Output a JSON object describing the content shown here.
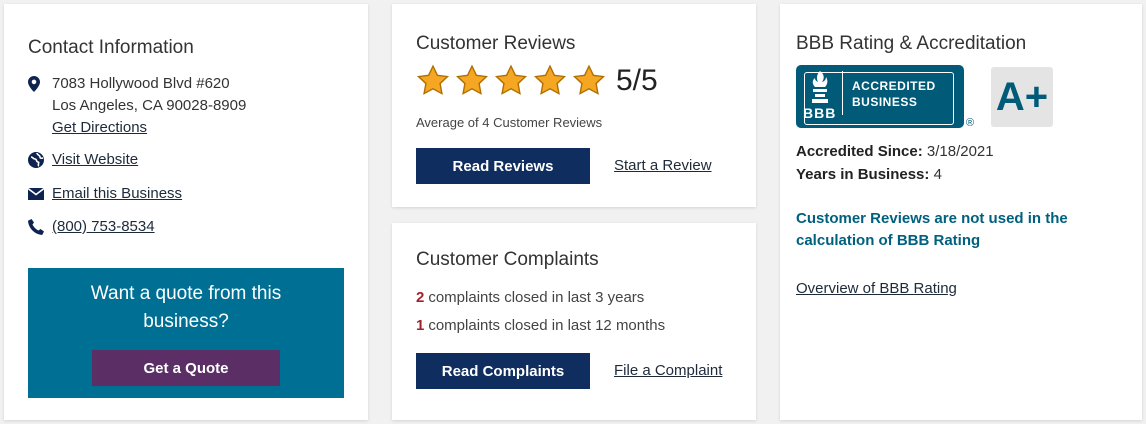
{
  "contact": {
    "title": "Contact Information",
    "address_line1": "7083 Hollywood Blvd #620",
    "address_line2": "Los Angeles, CA 90028-8909",
    "directions_label": "Get Directions",
    "website_label": "Visit Website",
    "email_label": "Email this Business",
    "phone": "(800) 753-8534",
    "quote_prompt": "Want a quote from this business?",
    "quote_button": "Get a Quote"
  },
  "reviews": {
    "title": "Customer Reviews",
    "stars": 5,
    "rating_text": "5/5",
    "average_text": "Average of 4 Customer Reviews",
    "read_button": "Read Reviews",
    "start_link": "Start a Review"
  },
  "complaints": {
    "title": "Customer Complaints",
    "lines": [
      {
        "count": "2",
        "text": "complaints closed in last 3 years"
      },
      {
        "count": "1",
        "text": "complaints closed in last 12 months"
      }
    ],
    "read_button": "Read Complaints",
    "file_link": "File a Complaint"
  },
  "bbb": {
    "title": "BBB Rating & Accreditation",
    "seal_line1": "ACCREDITED",
    "seal_line2": "BUSINESS",
    "seal_logo_text": "BBB",
    "seal_reg": "®",
    "grade": "A+",
    "accredited_since_label": "Accredited Since:",
    "accredited_since_value": "3/18/2021",
    "years_label": "Years in Business:",
    "years_value": "4",
    "notice": "Customer Reviews are not used in the calculation of BBB Rating",
    "overview_link": "Overview of BBB Rating"
  },
  "colors": {
    "navy": "#0f2d5e",
    "teal": "#006f94",
    "purple": "#5c2e66",
    "star": "#f5a623",
    "complaint_red": "#a3222a"
  },
  "icons": [
    "map-pin-icon",
    "globe-icon",
    "envelope-icon",
    "phone-icon",
    "star-icon",
    "bbb-torch-icon"
  ]
}
